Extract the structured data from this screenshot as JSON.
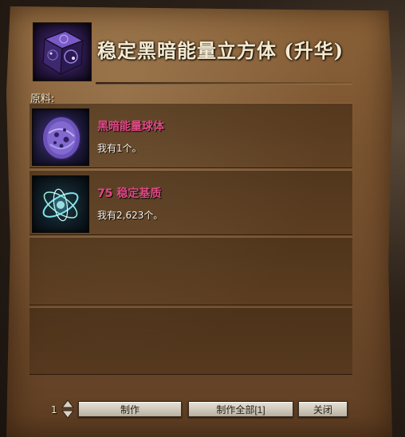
{
  "header": {
    "title": "稳定黑暗能量立方体 (升华)",
    "icon": "dark-energy-cube-icon"
  },
  "materials": {
    "label": "原料:",
    "items": [
      {
        "name": "黑暗能量球体",
        "owned": "我有1个。",
        "icon": "dark-energy-orb-icon"
      },
      {
        "name": "75 稳定基质",
        "owned": "我有2,623个。",
        "icon": "stabilizing-matrix-icon"
      }
    ]
  },
  "footer": {
    "quantity": "1",
    "craft_label": "制作",
    "craft_all_label": "制作全部[1]",
    "close_label": "关闭"
  },
  "colors": {
    "material_name": "#e04a86",
    "title": "#f5ead0"
  }
}
